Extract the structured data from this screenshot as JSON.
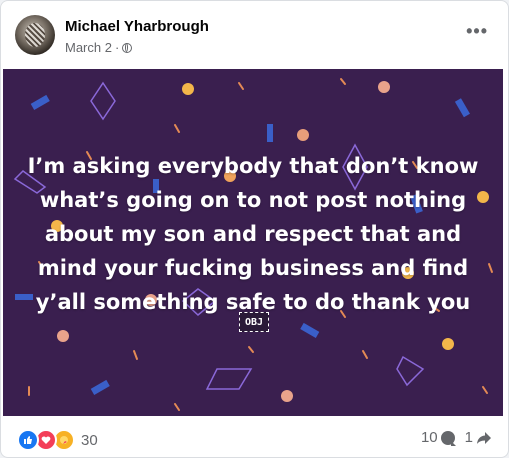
{
  "post": {
    "author": "Michael Yharbrough",
    "date": "March 2",
    "separator": "·",
    "privacy_icon": "globe-icon",
    "more_label": "•••",
    "text": "I’m asking everybody that don’t know what’s going on to not post nothing about my son and respect that and mind your fucking business and find y’all something safe to do thank you",
    "obj_placeholder": "OBJ",
    "background_color": "#3a1f4f"
  },
  "footer": {
    "reaction_icons": [
      "like-icon",
      "love-icon",
      "care-icon"
    ],
    "reaction_count": "30",
    "comment_count": "10",
    "share_count": "1"
  },
  "colors": {
    "like": "#1877f2",
    "love": "#f33e58",
    "care": "#f7b125",
    "secondary_text": "#65676b"
  }
}
